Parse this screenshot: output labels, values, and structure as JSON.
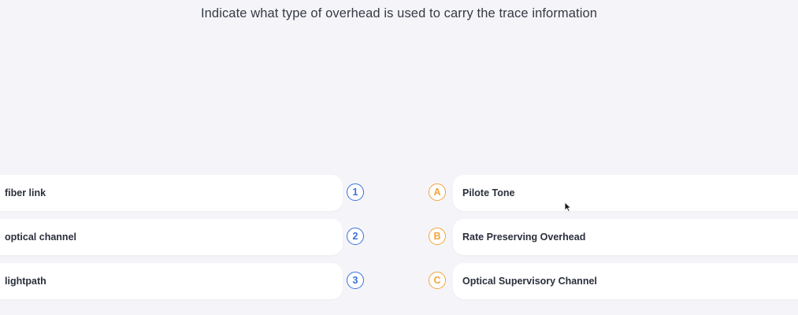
{
  "question": "Indicate what type of overhead is used to carry the trace information",
  "colors": {
    "number_badge": "#3b6fe0",
    "letter_badge": "#f4a23a",
    "background": "#f5f5f9",
    "card": "#ffffff"
  },
  "left_items": [
    {
      "badge": "1",
      "label": "fiber link"
    },
    {
      "badge": "2",
      "label": "optical channel"
    },
    {
      "badge": "3",
      "label": "lightpath"
    }
  ],
  "right_items": [
    {
      "badge": "A",
      "label": "Pilote Tone"
    },
    {
      "badge": "B",
      "label": "Rate Preserving Overhead"
    },
    {
      "badge": "C",
      "label": "Optical Supervisory Channel"
    }
  ],
  "cursor_icon": "arrow-cursor-icon"
}
